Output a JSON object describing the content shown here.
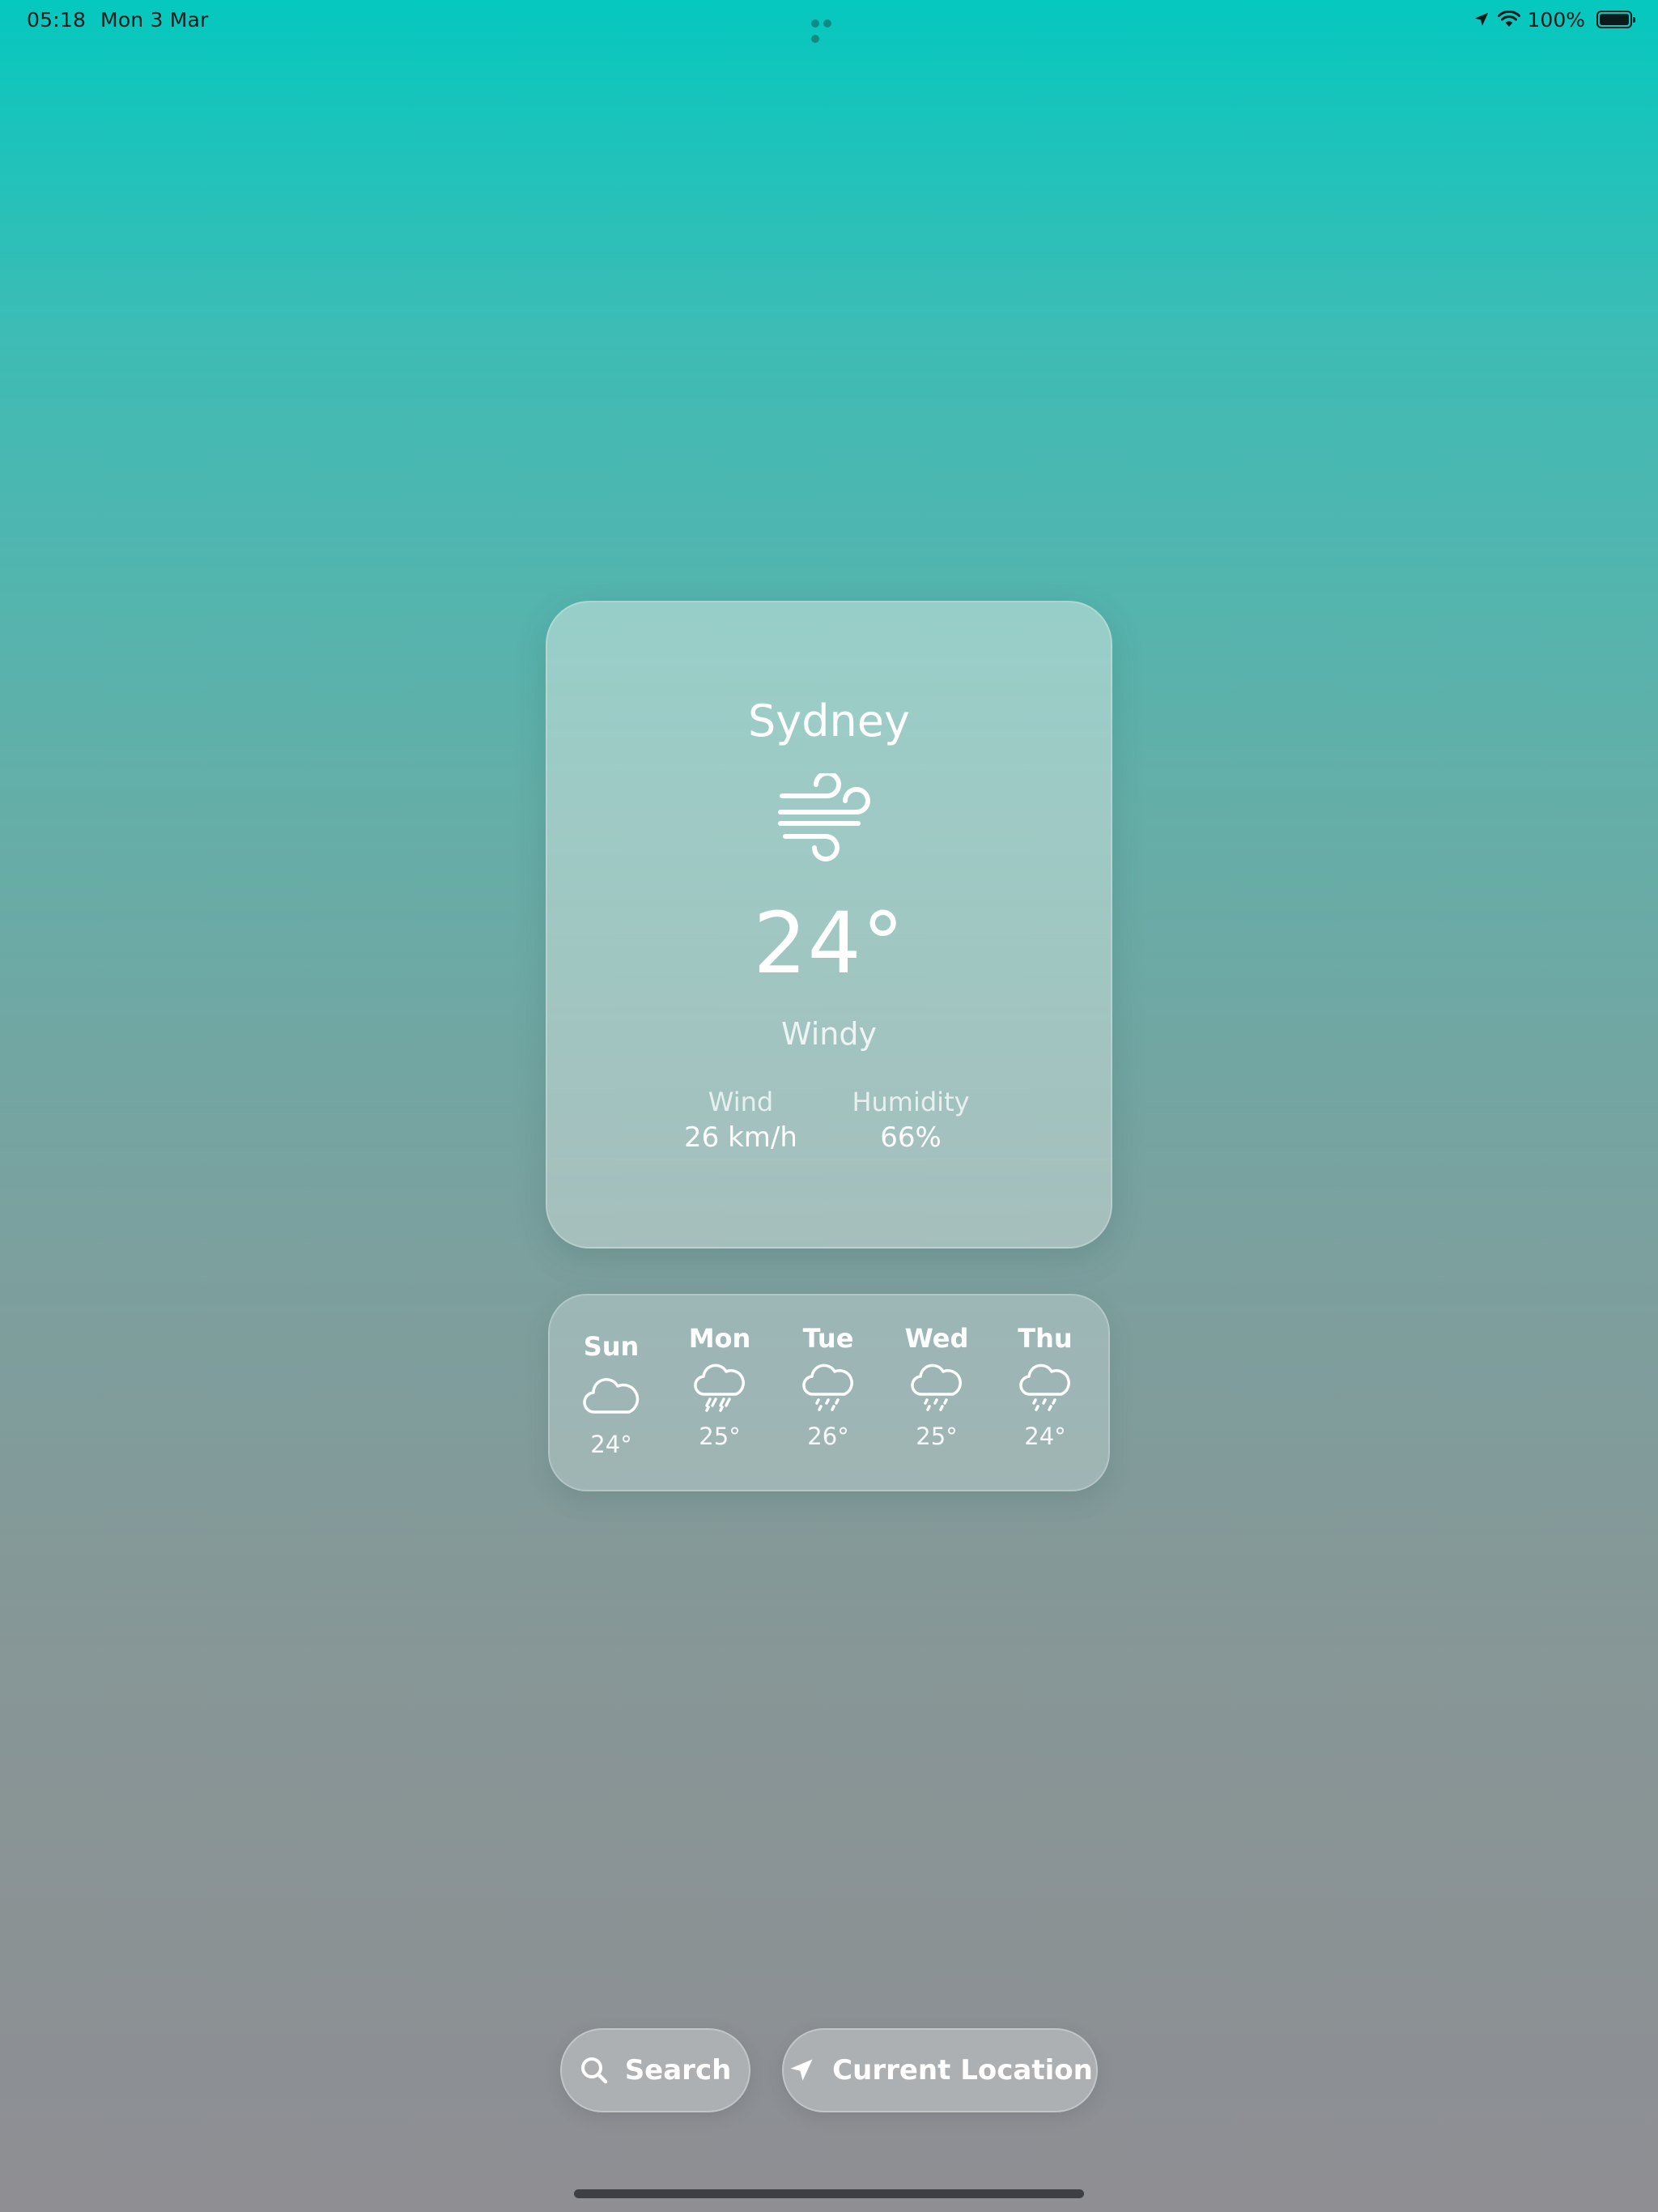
{
  "status_bar": {
    "time": "05:18",
    "date": "Mon 3 Mar",
    "battery": "100%",
    "icons": [
      "location-arrow-icon",
      "wifi-icon",
      "battery-icon"
    ]
  },
  "current": {
    "city": "Sydney",
    "condition_icon": "wind-icon",
    "temperature": "24°",
    "condition": "Windy",
    "wind_label": "Wind",
    "wind_value": "26 km/h",
    "humidity_label": "Humidity",
    "humidity_value": "66%"
  },
  "forecast": [
    {
      "day": "Sun",
      "icon": "cloud-icon",
      "temp": "24°"
    },
    {
      "day": "Mon",
      "icon": "cloud-heavy-rain-icon",
      "temp": "25°"
    },
    {
      "day": "Tue",
      "icon": "cloud-drizzle-icon",
      "temp": "26°"
    },
    {
      "day": "Wed",
      "icon": "cloud-drizzle-icon",
      "temp": "25°"
    },
    {
      "day": "Thu",
      "icon": "cloud-drizzle-icon",
      "temp": "24°"
    }
  ],
  "buttons": {
    "search_label": "Search",
    "search_icon": "magnifying-glass-icon",
    "location_label": "Current Location",
    "location_icon": "location-arrow-icon"
  },
  "colors": {
    "background_top": "#05c8bf",
    "background_bottom": "#8e8e93",
    "text": "#ffffff"
  }
}
